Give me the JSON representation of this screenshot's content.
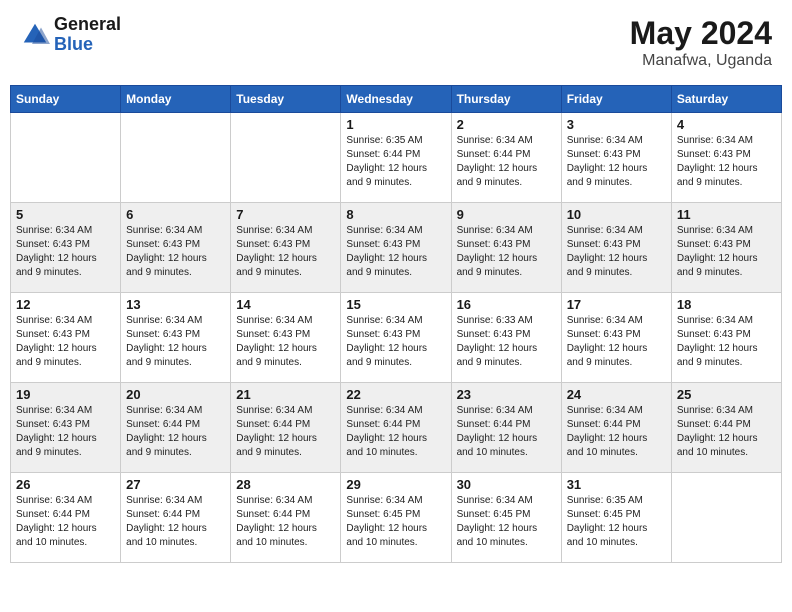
{
  "header": {
    "logo_general": "General",
    "logo_blue": "Blue",
    "month_title": "May 2024",
    "location": "Manafwa, Uganda"
  },
  "calendar": {
    "days": [
      "Sunday",
      "Monday",
      "Tuesday",
      "Wednesday",
      "Thursday",
      "Friday",
      "Saturday"
    ],
    "weeks": [
      [
        {
          "date": "",
          "info": ""
        },
        {
          "date": "",
          "info": ""
        },
        {
          "date": "",
          "info": ""
        },
        {
          "date": "1",
          "info": "Sunrise: 6:35 AM\nSunset: 6:44 PM\nDaylight: 12 hours and 9 minutes."
        },
        {
          "date": "2",
          "info": "Sunrise: 6:34 AM\nSunset: 6:44 PM\nDaylight: 12 hours and 9 minutes."
        },
        {
          "date": "3",
          "info": "Sunrise: 6:34 AM\nSunset: 6:43 PM\nDaylight: 12 hours and 9 minutes."
        },
        {
          "date": "4",
          "info": "Sunrise: 6:34 AM\nSunset: 6:43 PM\nDaylight: 12 hours and 9 minutes."
        }
      ],
      [
        {
          "date": "5",
          "info": "Sunrise: 6:34 AM\nSunset: 6:43 PM\nDaylight: 12 hours and 9 minutes."
        },
        {
          "date": "6",
          "info": "Sunrise: 6:34 AM\nSunset: 6:43 PM\nDaylight: 12 hours and 9 minutes."
        },
        {
          "date": "7",
          "info": "Sunrise: 6:34 AM\nSunset: 6:43 PM\nDaylight: 12 hours and 9 minutes."
        },
        {
          "date": "8",
          "info": "Sunrise: 6:34 AM\nSunset: 6:43 PM\nDaylight: 12 hours and 9 minutes."
        },
        {
          "date": "9",
          "info": "Sunrise: 6:34 AM\nSunset: 6:43 PM\nDaylight: 12 hours and 9 minutes."
        },
        {
          "date": "10",
          "info": "Sunrise: 6:34 AM\nSunset: 6:43 PM\nDaylight: 12 hours and 9 minutes."
        },
        {
          "date": "11",
          "info": "Sunrise: 6:34 AM\nSunset: 6:43 PM\nDaylight: 12 hours and 9 minutes."
        }
      ],
      [
        {
          "date": "12",
          "info": "Sunrise: 6:34 AM\nSunset: 6:43 PM\nDaylight: 12 hours and 9 minutes."
        },
        {
          "date": "13",
          "info": "Sunrise: 6:34 AM\nSunset: 6:43 PM\nDaylight: 12 hours and 9 minutes."
        },
        {
          "date": "14",
          "info": "Sunrise: 6:34 AM\nSunset: 6:43 PM\nDaylight: 12 hours and 9 minutes."
        },
        {
          "date": "15",
          "info": "Sunrise: 6:34 AM\nSunset: 6:43 PM\nDaylight: 12 hours and 9 minutes."
        },
        {
          "date": "16",
          "info": "Sunrise: 6:33 AM\nSunset: 6:43 PM\nDaylight: 12 hours and 9 minutes."
        },
        {
          "date": "17",
          "info": "Sunrise: 6:34 AM\nSunset: 6:43 PM\nDaylight: 12 hours and 9 minutes."
        },
        {
          "date": "18",
          "info": "Sunrise: 6:34 AM\nSunset: 6:43 PM\nDaylight: 12 hours and 9 minutes."
        }
      ],
      [
        {
          "date": "19",
          "info": "Sunrise: 6:34 AM\nSunset: 6:43 PM\nDaylight: 12 hours and 9 minutes."
        },
        {
          "date": "20",
          "info": "Sunrise: 6:34 AM\nSunset: 6:44 PM\nDaylight: 12 hours and 9 minutes."
        },
        {
          "date": "21",
          "info": "Sunrise: 6:34 AM\nSunset: 6:44 PM\nDaylight: 12 hours and 9 minutes."
        },
        {
          "date": "22",
          "info": "Sunrise: 6:34 AM\nSunset: 6:44 PM\nDaylight: 12 hours and 10 minutes."
        },
        {
          "date": "23",
          "info": "Sunrise: 6:34 AM\nSunset: 6:44 PM\nDaylight: 12 hours and 10 minutes."
        },
        {
          "date": "24",
          "info": "Sunrise: 6:34 AM\nSunset: 6:44 PM\nDaylight: 12 hours and 10 minutes."
        },
        {
          "date": "25",
          "info": "Sunrise: 6:34 AM\nSunset: 6:44 PM\nDaylight: 12 hours and 10 minutes."
        }
      ],
      [
        {
          "date": "26",
          "info": "Sunrise: 6:34 AM\nSunset: 6:44 PM\nDaylight: 12 hours and 10 minutes."
        },
        {
          "date": "27",
          "info": "Sunrise: 6:34 AM\nSunset: 6:44 PM\nDaylight: 12 hours and 10 minutes."
        },
        {
          "date": "28",
          "info": "Sunrise: 6:34 AM\nSunset: 6:44 PM\nDaylight: 12 hours and 10 minutes."
        },
        {
          "date": "29",
          "info": "Sunrise: 6:34 AM\nSunset: 6:45 PM\nDaylight: 12 hours and 10 minutes."
        },
        {
          "date": "30",
          "info": "Sunrise: 6:34 AM\nSunset: 6:45 PM\nDaylight: 12 hours and 10 minutes."
        },
        {
          "date": "31",
          "info": "Sunrise: 6:35 AM\nSunset: 6:45 PM\nDaylight: 12 hours and 10 minutes."
        },
        {
          "date": "",
          "info": ""
        }
      ]
    ]
  }
}
